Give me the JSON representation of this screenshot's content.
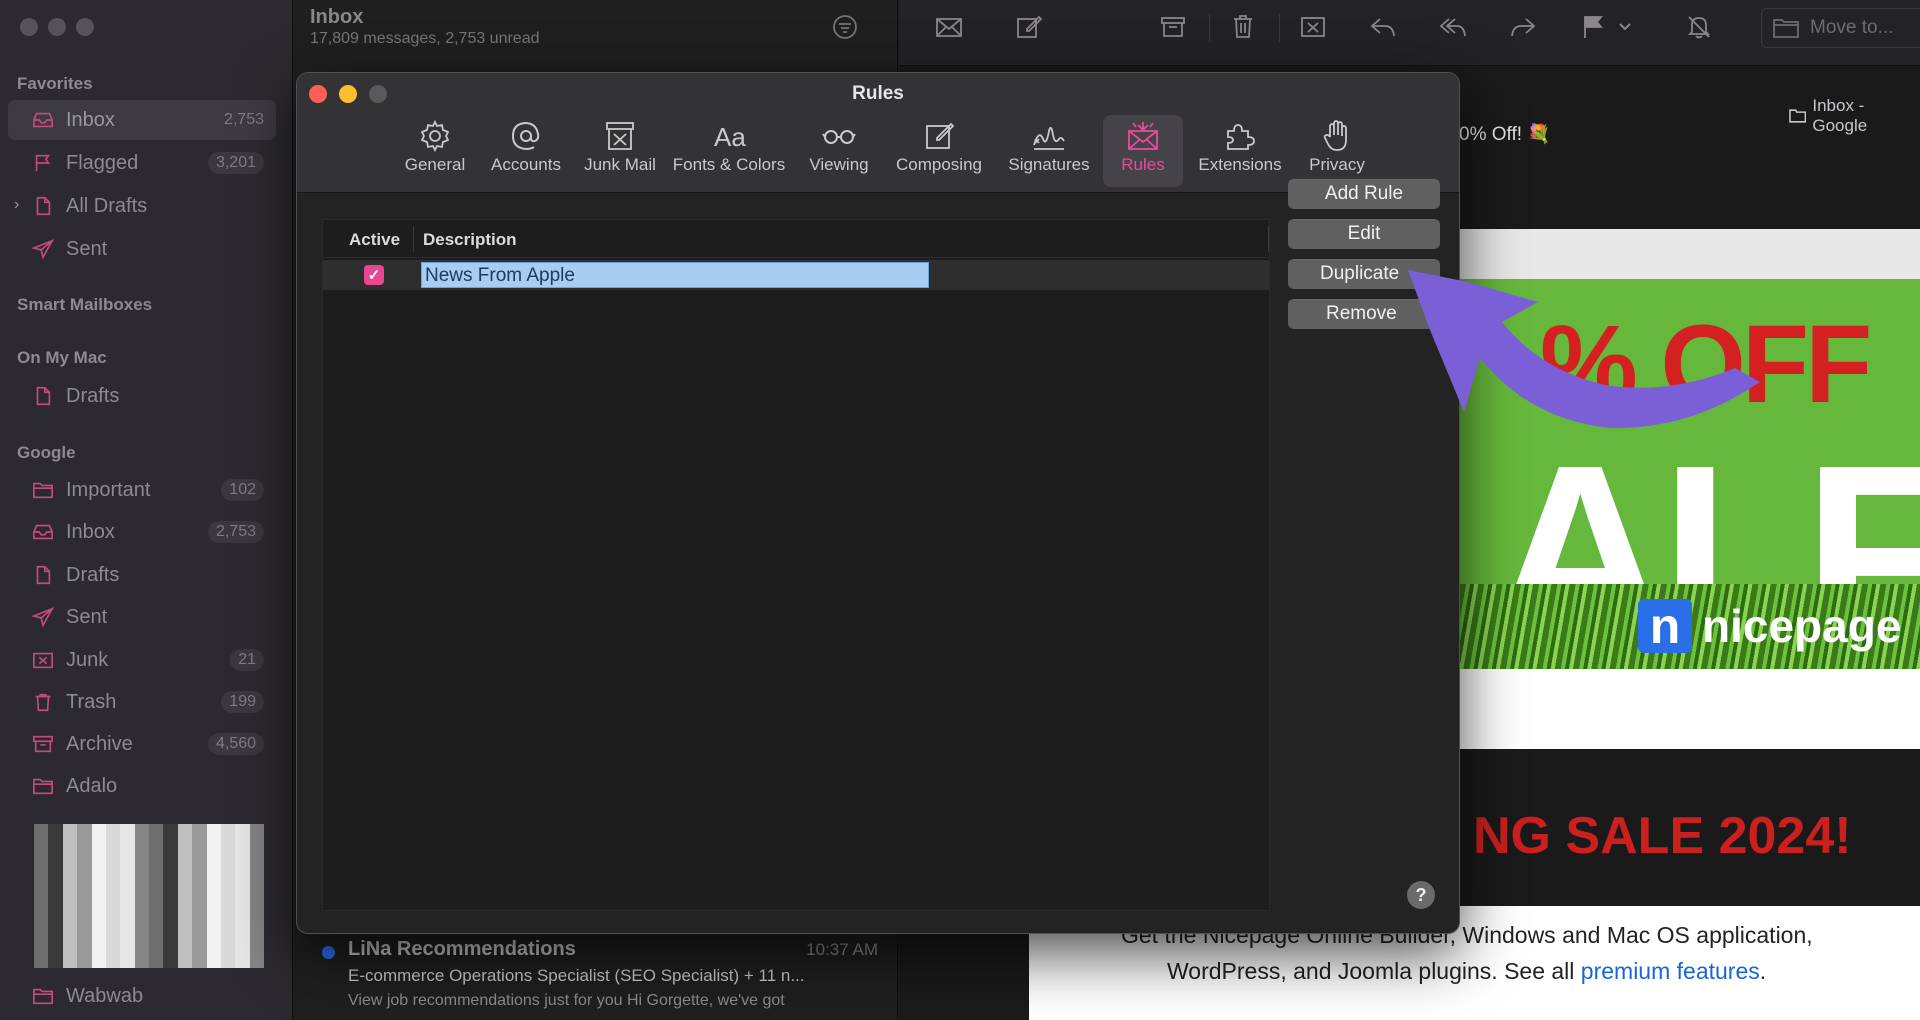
{
  "sidebar": {
    "sections": {
      "favorites": "Favorites",
      "smart": "Smart Mailboxes",
      "onmymac": "On My Mac",
      "google": "Google"
    },
    "favorites": [
      {
        "label": "Inbox",
        "count": "2,753",
        "icon": "inbox-icon"
      },
      {
        "label": "Flagged",
        "count": "3,201",
        "icon": "flag-icon"
      },
      {
        "label": "All Drafts",
        "count": "",
        "icon": "document-icon"
      },
      {
        "label": "Sent",
        "count": "",
        "icon": "paperplane-icon"
      }
    ],
    "onmymac": [
      {
        "label": "Drafts",
        "count": "",
        "icon": "document-icon"
      }
    ],
    "google": [
      {
        "label": "Important",
        "count": "102",
        "icon": "folder-icon"
      },
      {
        "label": "Inbox",
        "count": "2,753",
        "icon": "inbox-icon"
      },
      {
        "label": "Drafts",
        "count": "",
        "icon": "document-icon"
      },
      {
        "label": "Sent",
        "count": "",
        "icon": "paperplane-icon"
      },
      {
        "label": "Junk",
        "count": "21",
        "icon": "junk-icon"
      },
      {
        "label": "Trash",
        "count": "199",
        "icon": "trash-icon"
      },
      {
        "label": "Archive",
        "count": "4,560",
        "icon": "archive-icon"
      },
      {
        "label": "Adalo",
        "count": "",
        "icon": "folder-icon"
      },
      {
        "label": "Wabwab",
        "count": "",
        "icon": "folder-icon"
      }
    ]
  },
  "messagelist": {
    "title": "Inbox",
    "subtitle": "17,809 messages, 2,753 unread",
    "message": {
      "from": "LiNa Recommendations",
      "time": "10:37 AM",
      "subject": "E-commerce Operations Specialist (SEO Specialist) + 11 n...",
      "preview": "View job recommendations just for you Hi Gorgette, we've got"
    }
  },
  "toolbar": {
    "move_to": "Move to..."
  },
  "email": {
    "mailbox_label": "Inbox - Google",
    "subject_fragment": "0% Off! 💐",
    "banner_off": "% OFF",
    "banner_alf": "ALF",
    "brand": "nicepage",
    "brand_logo": "n",
    "sale_title": "NG SALE 2024!",
    "desc_line1": "Get the Nicepage Online Builder, Windows and Mac OS application,",
    "desc_line2_pre": "WordPress, and Joomla plugins. See all ",
    "desc_line2_link": "premium features",
    "desc_line2_post": "."
  },
  "dialog": {
    "title": "Rules",
    "tabs": [
      {
        "label": "General",
        "icon": "gear-icon"
      },
      {
        "label": "Accounts",
        "icon": "at-icon"
      },
      {
        "label": "Junk Mail",
        "icon": "junk-icon"
      },
      {
        "label": "Fonts & Colors",
        "icon": "fonts-icon"
      },
      {
        "label": "Viewing",
        "icon": "glasses-icon"
      },
      {
        "label": "Composing",
        "icon": "compose-icon"
      },
      {
        "label": "Signatures",
        "icon": "signature-icon"
      },
      {
        "label": "Rules",
        "icon": "rules-icon"
      },
      {
        "label": "Extensions",
        "icon": "puzzle-icon"
      },
      {
        "label": "Privacy",
        "icon": "hand-icon"
      }
    ],
    "active_tab": "Rules",
    "table": {
      "col_active": "Active",
      "col_description": "Description",
      "rows": [
        {
          "active": true,
          "description": "News From Apple"
        }
      ]
    },
    "buttons": {
      "add": "Add Rule",
      "edit": "Edit",
      "duplicate": "Duplicate",
      "remove": "Remove"
    },
    "help": "?"
  },
  "colors": {
    "accent_pink": "#e8478f",
    "arrow_purple": "#7b5fd6",
    "selection_blue": "#a7cdf2"
  }
}
